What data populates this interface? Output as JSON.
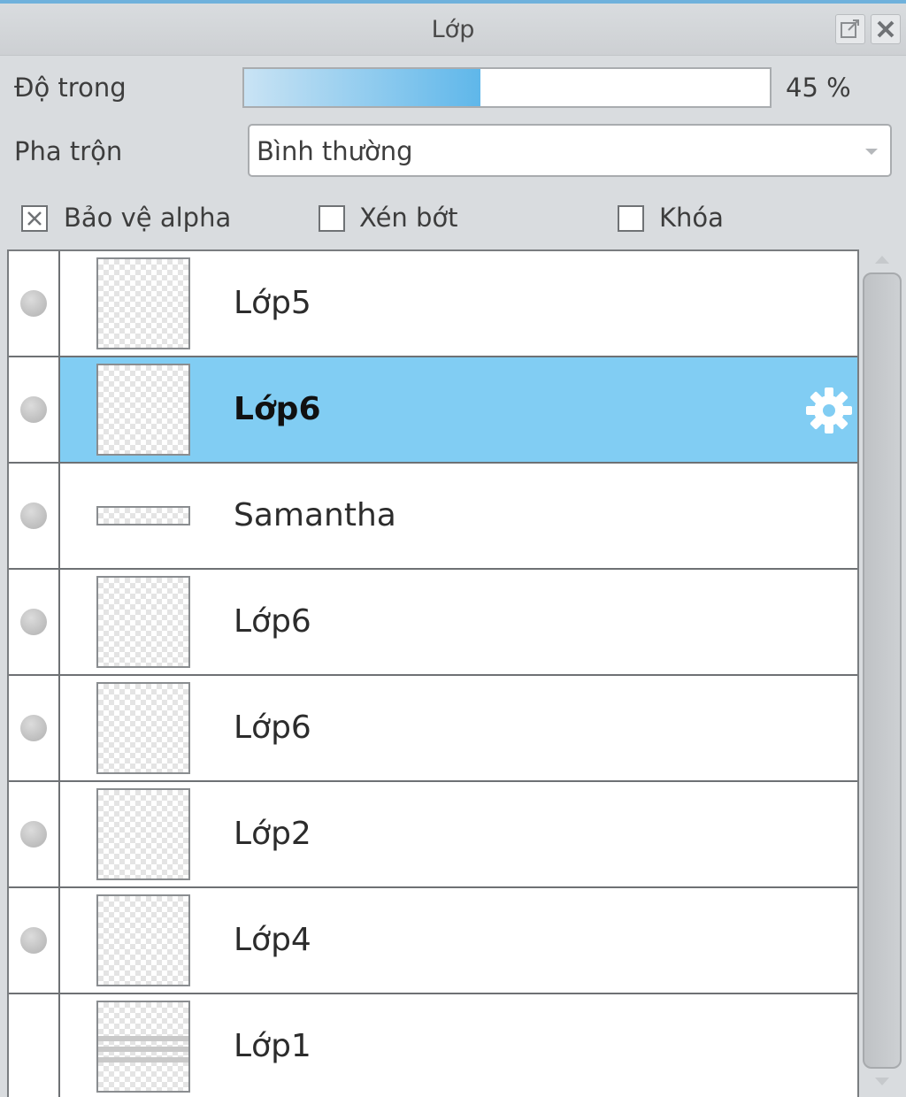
{
  "panel": {
    "title": "Lớp"
  },
  "opacity": {
    "label": "Độ trong",
    "value_text": "45 %",
    "value": 0.45
  },
  "blend": {
    "label": "Pha trộn",
    "selected": "Bình thường"
  },
  "options": {
    "protect_alpha": {
      "label": "Bảo vệ alpha",
      "checked": true
    },
    "clip": {
      "label": "Xén bớt",
      "checked": false
    },
    "lock": {
      "label": "Khóa",
      "checked": false
    }
  },
  "layers": [
    {
      "name": "Lớp5",
      "selected": false
    },
    {
      "name": "Lớp6",
      "selected": true
    },
    {
      "name": "Samantha",
      "selected": false
    },
    {
      "name": "Lớp6",
      "selected": false
    },
    {
      "name": "Lớp6",
      "selected": false
    },
    {
      "name": "Lớp2",
      "selected": false
    },
    {
      "name": "Lớp4",
      "selected": false
    },
    {
      "name": "Lớp1",
      "selected": false
    }
  ],
  "colors": {
    "accent": "#81cdf3",
    "selected_row": "#81cdf3",
    "slider_fill": "#5fb7ea"
  },
  "icons": {
    "popout": "popout-icon",
    "close": "close-icon",
    "gear": "gear-icon",
    "visibility": "visibility-dot-icon",
    "dropdown": "chevron-down-icon"
  }
}
